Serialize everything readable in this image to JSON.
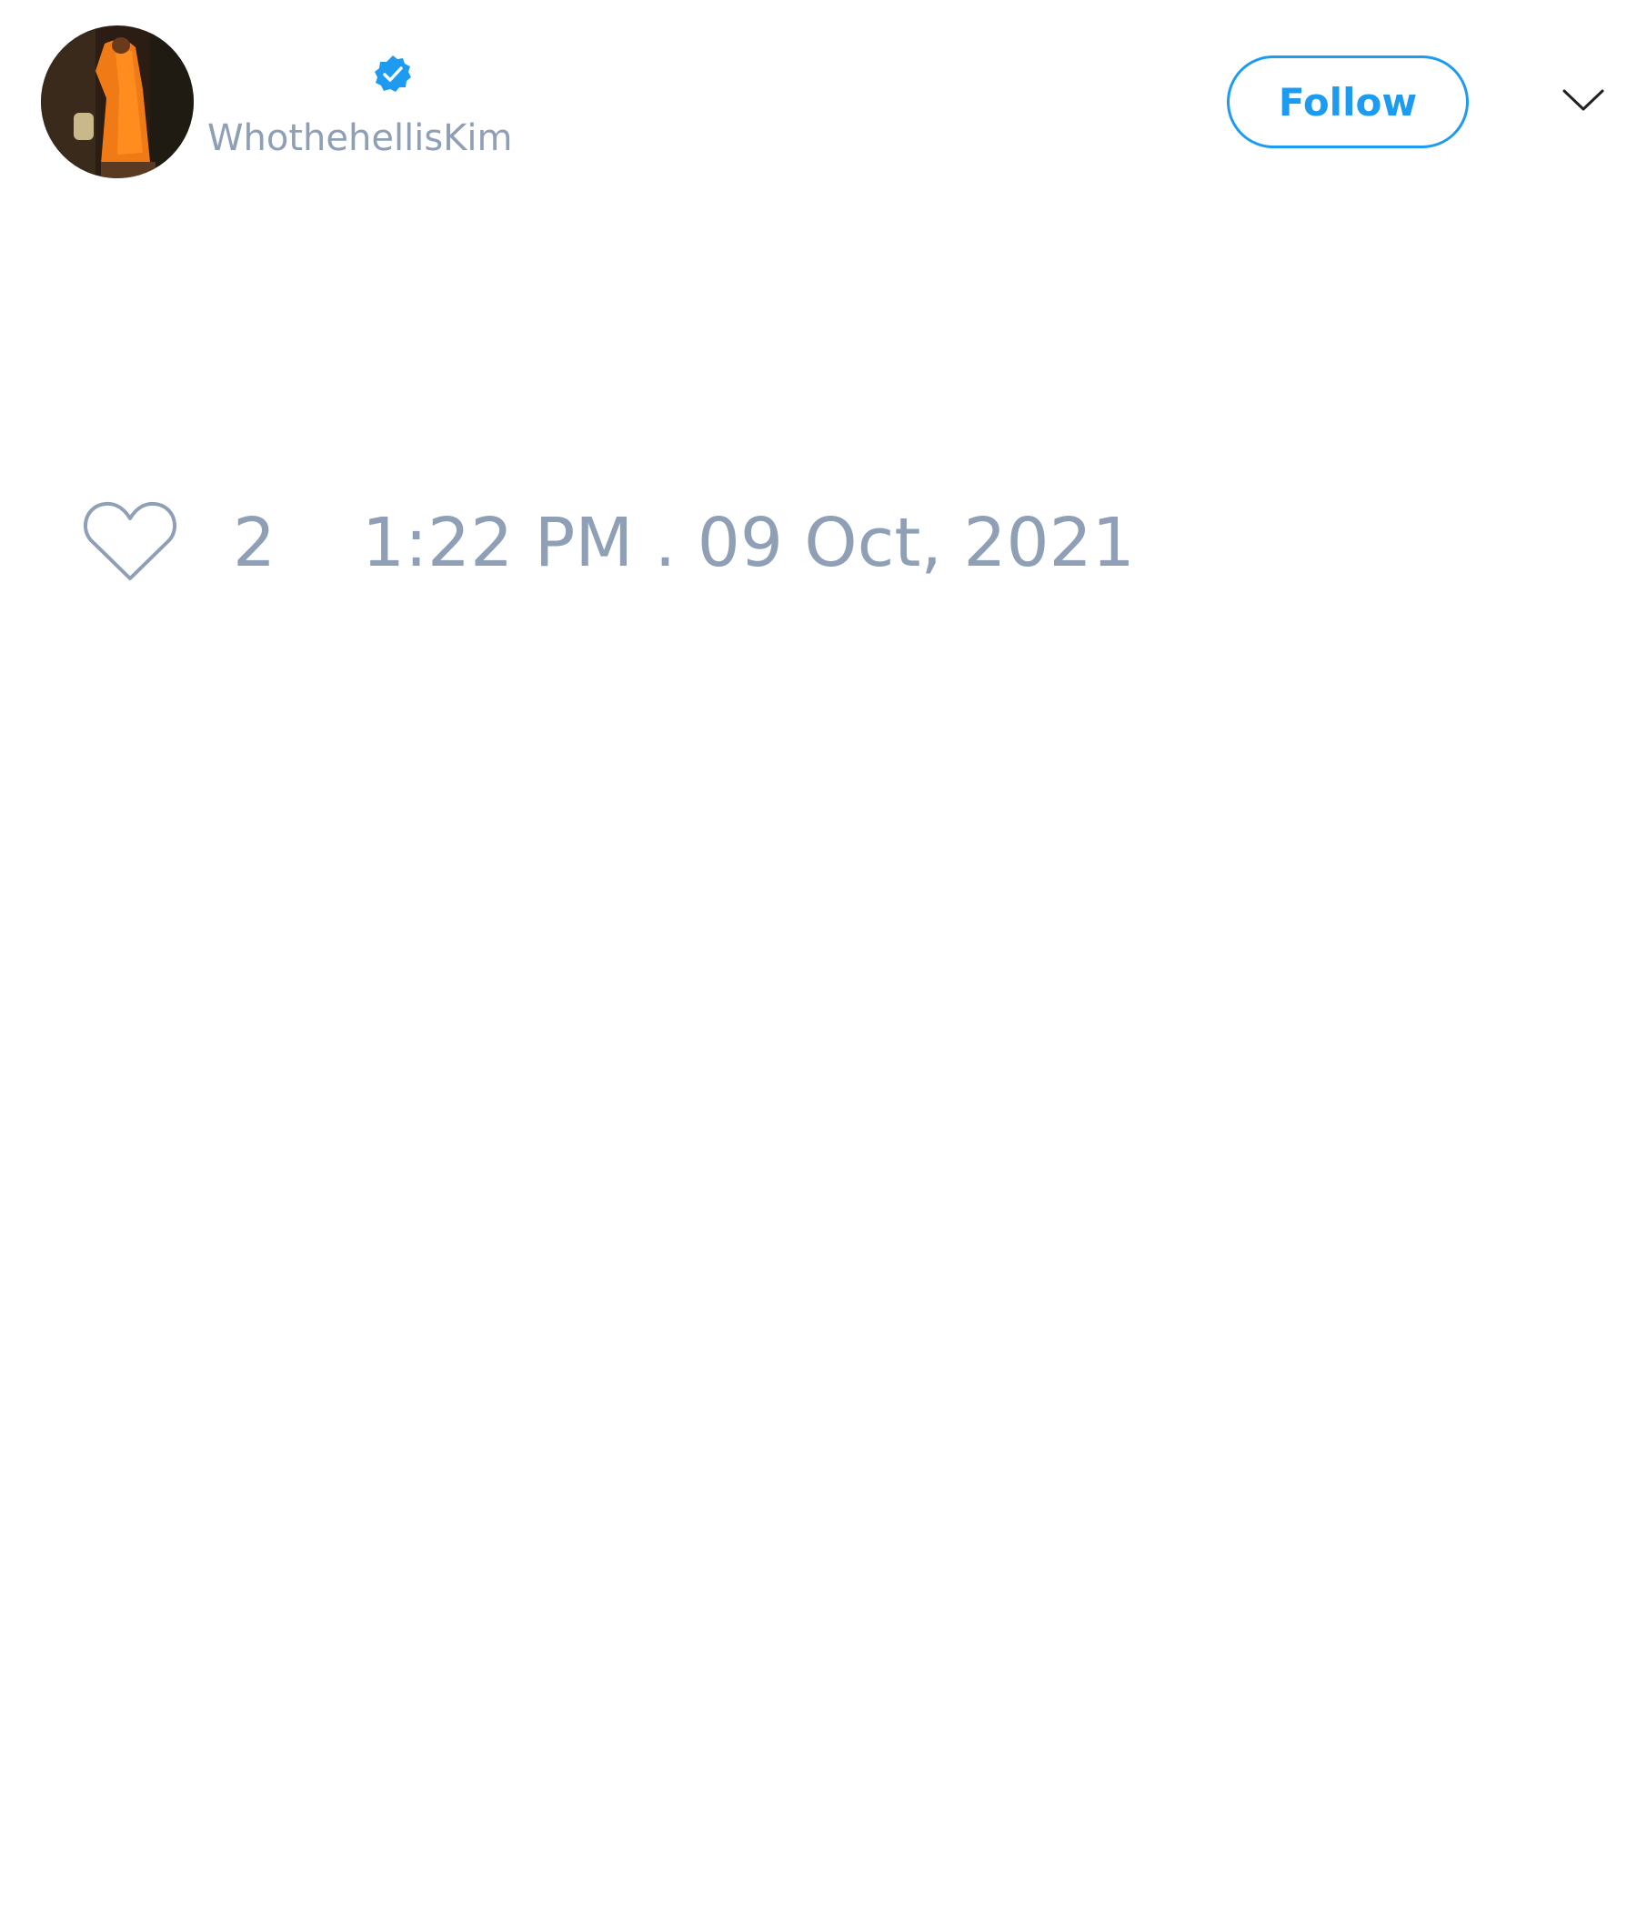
{
  "author": {
    "handle": "WhothehellisKim",
    "verified": true,
    "avatar_icon": "avatar-photo-orange-robe"
  },
  "header": {
    "follow_label": "Follow",
    "menu_icon": "chevron-down-icon"
  },
  "engagement": {
    "like_icon": "heart-icon",
    "like_count": "2"
  },
  "meta": {
    "timestamp": "1:22 PM . 09 Oct, 2021"
  },
  "colors": {
    "accent": "#1d9bf0",
    "muted_text": "#8e9fb6",
    "background": "#ffffff"
  }
}
